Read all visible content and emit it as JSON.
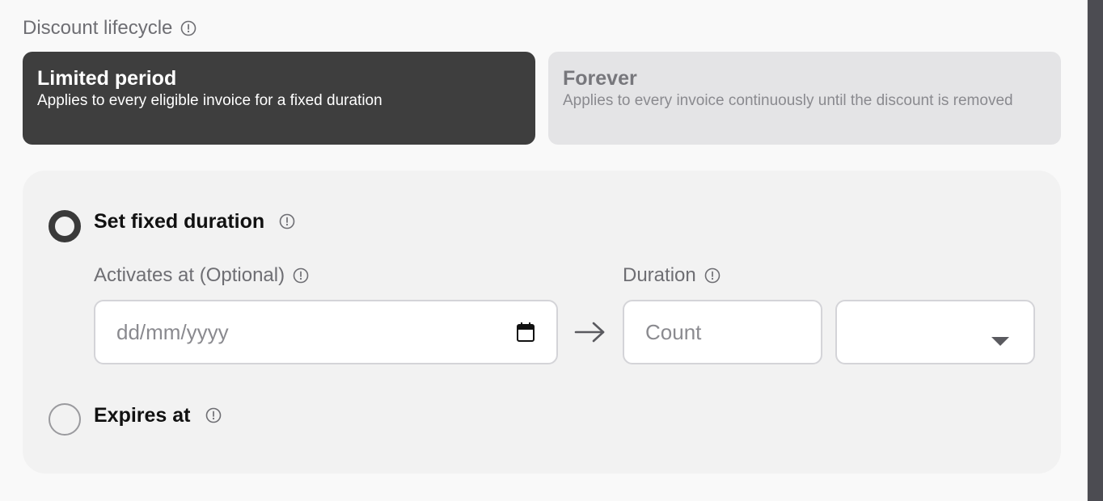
{
  "discount_lifecycle": {
    "label": "Discount lifecycle",
    "options": [
      {
        "title": "Limited period",
        "description": "Applies to every eligible invoice for a fixed duration",
        "selected": true
      },
      {
        "title": "Forever",
        "description": "Applies to every invoice continuously until the discount is removed",
        "selected": false
      }
    ]
  },
  "duration_panel": {
    "fixed_duration": {
      "label": "Set fixed duration",
      "checked": true,
      "activates_at": {
        "label": "Activates at (Optional)",
        "placeholder": "dd/mm/yyyy"
      },
      "duration": {
        "label": "Duration",
        "count_placeholder": "Count",
        "unit_value": ""
      }
    },
    "expires_at": {
      "label": "Expires at",
      "checked": false
    }
  },
  "icons": {
    "info": "info-circle-icon",
    "calendar": "calendar-icon",
    "arrow": "arrow-right-icon",
    "dropdown": "caret-down-icon"
  },
  "colors": {
    "selected_card_bg": "#3e3e3e",
    "unselected_card_bg": "#e4e4e6",
    "panel_bg": "#f2f2f2",
    "page_bg": "#f9f9f9"
  }
}
